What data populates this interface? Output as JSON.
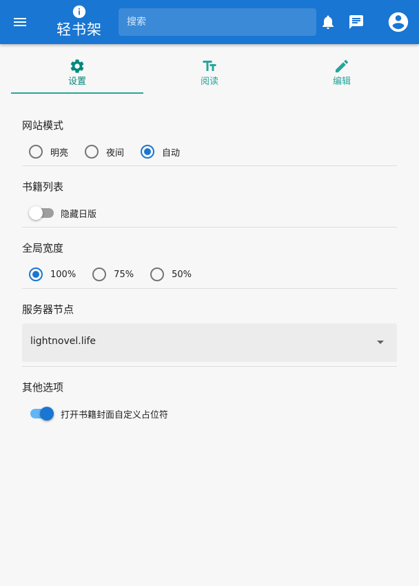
{
  "app": {
    "title": "轻书架"
  },
  "search": {
    "placeholder": "搜索"
  },
  "tabs": [
    {
      "label": "设置",
      "icon": "gear-icon",
      "active": true
    },
    {
      "label": "阅读",
      "icon": "text-size-icon",
      "active": false
    },
    {
      "label": "编辑",
      "icon": "pencil-icon",
      "active": false
    }
  ],
  "settings": {
    "site_mode": {
      "title": "网站模式",
      "options": [
        "明亮",
        "夜间",
        "自动"
      ],
      "selected": "自动"
    },
    "book_list": {
      "title": "书籍列表",
      "toggle_label": "隐藏日版",
      "toggle_on": false
    },
    "global_width": {
      "title": "全局宽度",
      "options": [
        "100%",
        "75%",
        "50%"
      ],
      "selected": "100%"
    },
    "server_node": {
      "title": "服务器节点",
      "value": "lightnovel.life"
    },
    "other": {
      "title": "其他选项",
      "toggle_label": "打开书籍封面自定义占位符",
      "toggle_on": true
    }
  },
  "colors": {
    "primary": "#1976d2",
    "accent": "#26a69a",
    "background": "#f7f7f7"
  }
}
